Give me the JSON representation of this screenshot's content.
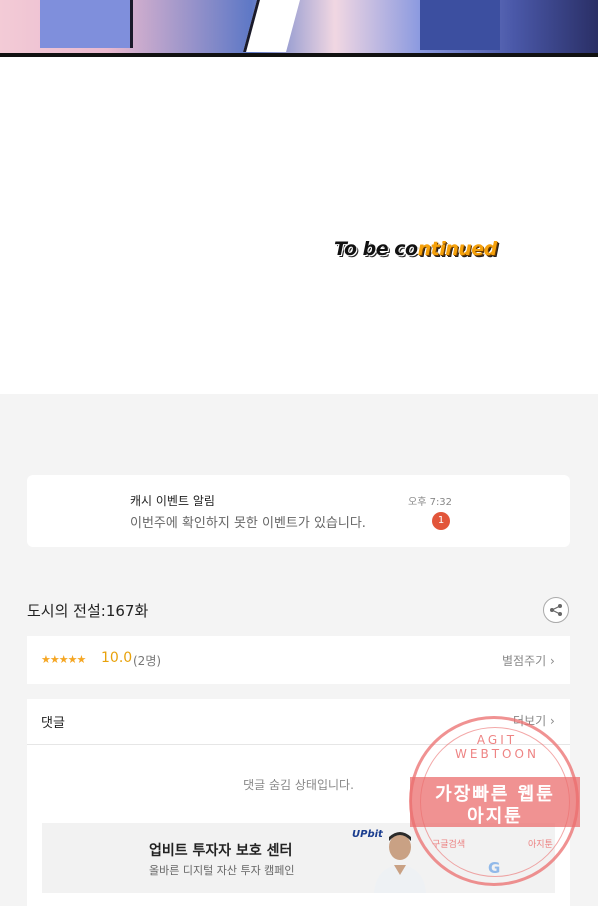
{
  "comic": {
    "end_text_part1": "To be co",
    "end_text_part2": "ntinued"
  },
  "notification": {
    "title": "캐시 이벤트 알림",
    "body": "이번주에 확인하지 못한 이벤트가 있습니다.",
    "time": "오후 7:32",
    "badge_count": "1"
  },
  "episode": {
    "title": "도시의 전설:167화",
    "share_icon": "share-icon"
  },
  "rating": {
    "stars": "★★★★★",
    "score": "10.0",
    "count": "(2명)",
    "rate_link": "별점주기",
    "chevron": "›"
  },
  "comments": {
    "header": "댓글",
    "more_link": "더보기",
    "chevron": "›",
    "hidden_message": "댓글 숨김 상태입니다."
  },
  "ad": {
    "logo": "UPbit",
    "title": "업비트 투자자 보호 센터",
    "subtitle": "올바른 디지털 자산 투자 캠페인"
  },
  "watermark": {
    "arc_text": "AGIT WEBTOON",
    "line1": "가장빠른 웹툰",
    "line2": "아지툰",
    "left_text": "구글검색",
    "right_text": "아지툰",
    "g_letter": "G"
  },
  "colors": {
    "accent_orange": "#e8a20c",
    "badge_red": "#e2553a",
    "watermark": "#eb6e6e"
  }
}
